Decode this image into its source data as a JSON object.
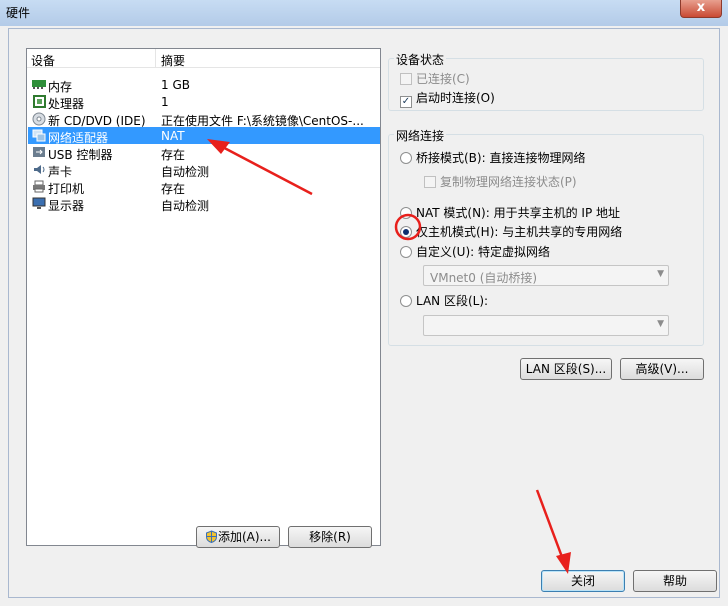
{
  "window": {
    "title": "硬件",
    "close_glyph": "x"
  },
  "device_list": {
    "columns": {
      "device": "设备",
      "summary": "摘要"
    },
    "rows": [
      {
        "icon": "memory-icon",
        "name": "内存",
        "summary": "1 GB"
      },
      {
        "icon": "cpu-icon",
        "name": "处理器",
        "summary": "1"
      },
      {
        "icon": "disc-icon",
        "name": "新 CD/DVD (IDE)",
        "summary": "正在使用文件 F:\\系统镜像\\CentOS-..."
      },
      {
        "icon": "network-icon",
        "name": "网络适配器",
        "summary": "NAT",
        "selected": true
      },
      {
        "icon": "usb-icon",
        "name": "USB 控制器",
        "summary": "存在"
      },
      {
        "icon": "sound-icon",
        "name": "声卡",
        "summary": "自动检测"
      },
      {
        "icon": "printer-icon",
        "name": "打印机",
        "summary": "存在"
      },
      {
        "icon": "monitor-icon",
        "name": "显示器",
        "summary": "自动检测"
      }
    ]
  },
  "buttons": {
    "add": "添加(A)...",
    "remove": "移除(R)",
    "lan_segments": "LAN 区段(S)...",
    "advanced": "高级(V)...",
    "close": "关闭",
    "help": "帮助"
  },
  "device_status": {
    "title": "设备状态",
    "connected": {
      "label": "已连接(C)",
      "checked": false,
      "disabled": true
    },
    "connect_at_power_on": {
      "label": "启动时连接(O)",
      "checked": true
    }
  },
  "network_connection": {
    "title": "网络连接",
    "bridged": "桥接模式(B): 直接连接物理网络",
    "replicate": "复制物理网络连接状态(P)",
    "nat": "NAT 模式(N): 用于共享主机的 IP 地址",
    "host_only": "仅主机模式(H): 与主机共享的专用网络",
    "custom": "自定义(U): 特定虚拟网络",
    "custom_value": "VMnet0 (自动桥接)",
    "lan_segment": "LAN 区段(L):",
    "lan_segment_value": "",
    "selected": "host_only"
  },
  "colors": {
    "selection": "#3399ff",
    "annotation": "#e8201c"
  }
}
